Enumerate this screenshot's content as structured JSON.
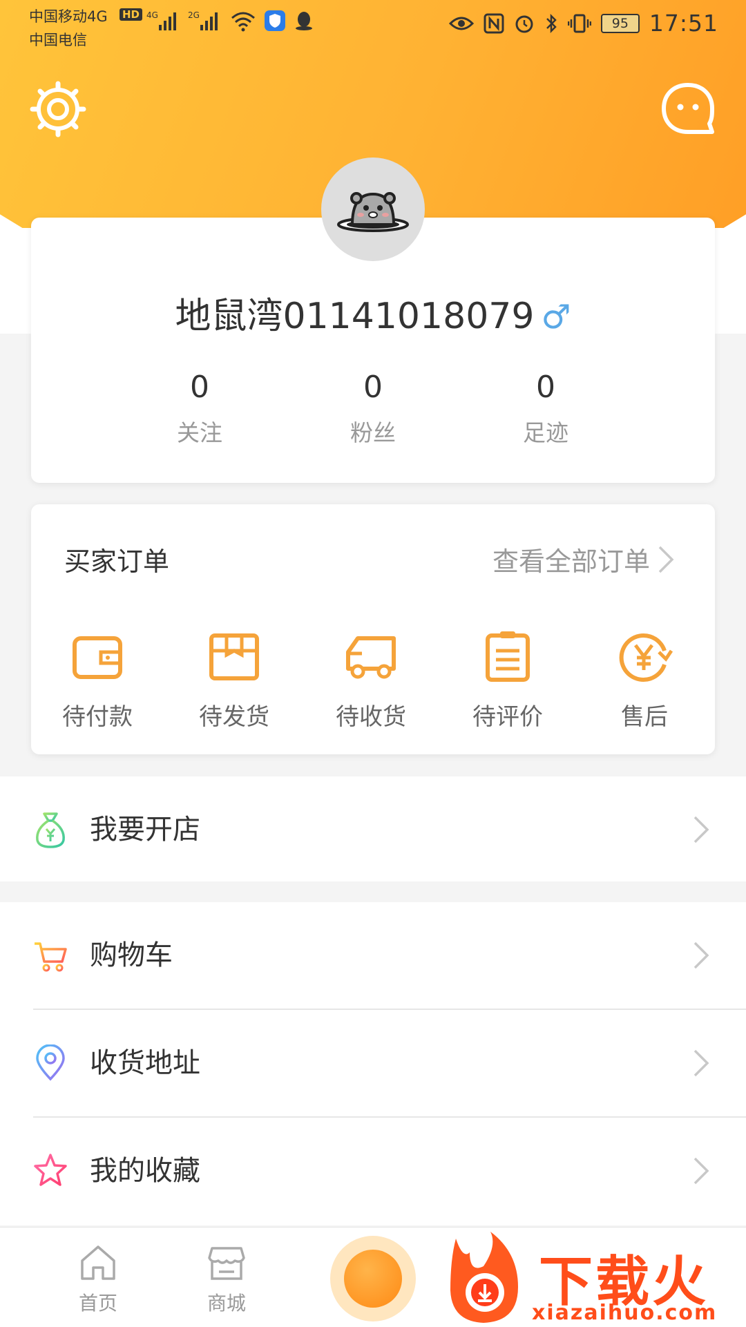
{
  "status_bar": {
    "carrier_1": "中国移动4G",
    "hd_badge": "HD",
    "carrier_2": "中国电信",
    "signal_1": "4G",
    "signal_2": "2G",
    "battery": "95",
    "time": "17:51"
  },
  "profile": {
    "username": "地鼠湾01141018079",
    "gender_symbol": "♂",
    "stats": [
      {
        "value": "0",
        "label": "关注"
      },
      {
        "value": "0",
        "label": "粉丝"
      },
      {
        "value": "0",
        "label": "足迹"
      }
    ]
  },
  "orders": {
    "title": "买家订单",
    "view_all": "查看全部订单",
    "items": [
      {
        "label": "待付款",
        "icon": "wallet-icon"
      },
      {
        "label": "待发货",
        "icon": "package-icon"
      },
      {
        "label": "待收货",
        "icon": "truck-icon"
      },
      {
        "label": "待评价",
        "icon": "clipboard-icon"
      },
      {
        "label": "售后",
        "icon": "yen-refresh-icon"
      }
    ]
  },
  "menu": {
    "open_store": "我要开店",
    "cart": "购物车",
    "address": "收货地址",
    "favorites": "我的收藏"
  },
  "tabbar": {
    "home": "首页",
    "mall": "商城"
  },
  "watermark": {
    "text": "下载火",
    "url": "xiazaihuo.com"
  },
  "colors": {
    "accent": "#ffb233",
    "icon_orange": "#f5a33a",
    "gender_blue": "#5aa8e6"
  }
}
